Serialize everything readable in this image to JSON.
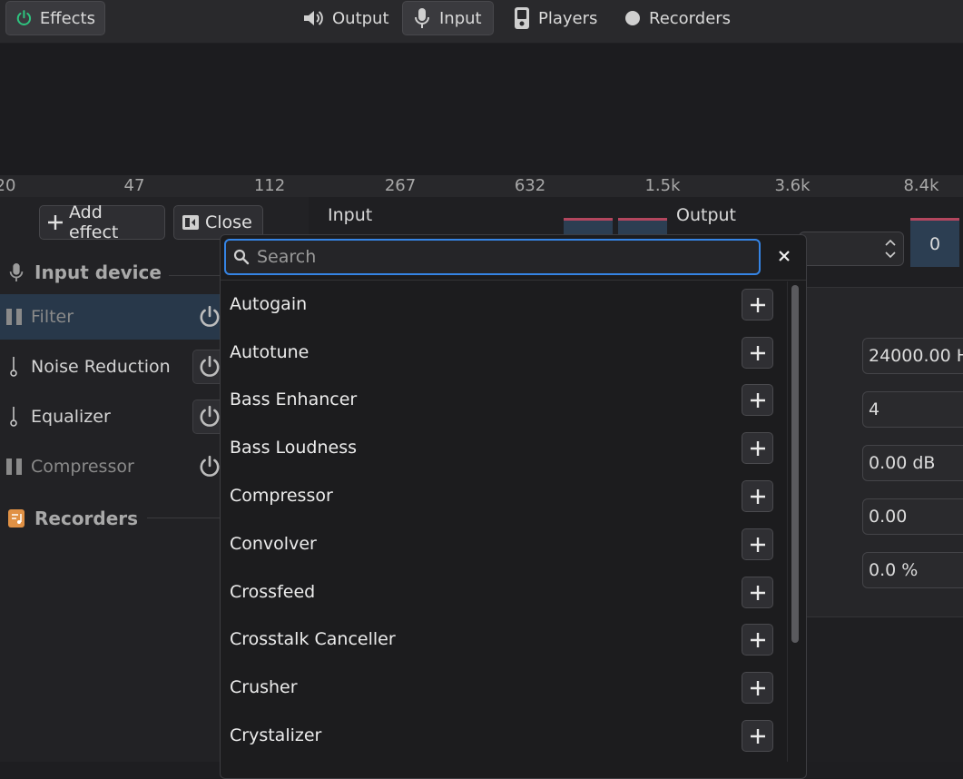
{
  "header": {
    "effects_label": "Effects",
    "tabs": [
      {
        "label": "Output",
        "icon": "speaker-icon"
      },
      {
        "label": "Input",
        "icon": "microphone-icon"
      },
      {
        "label": "Players",
        "icon": "player-device-icon"
      },
      {
        "label": "Recorders",
        "icon": "record-dot-icon"
      }
    ]
  },
  "frequency_axis": [
    "20",
    "47",
    "112",
    "267",
    "632",
    "1.5k",
    "3.6k",
    "8.4k"
  ],
  "toolbar": {
    "add_effect_label": "Add effect",
    "close_label": "Close"
  },
  "sidebar": {
    "input_device_label": "Input device",
    "items": [
      {
        "label": "Filter",
        "state": "paused"
      },
      {
        "label": "Noise Reduction",
        "state": "active"
      },
      {
        "label": "Equalizer",
        "state": "active"
      },
      {
        "label": "Compressor",
        "state": "paused"
      }
    ],
    "recorders_label": "Recorders"
  },
  "levels": {
    "input_label": "Input",
    "output_label": "Output",
    "output_value": "0"
  },
  "properties": {
    "values": [
      "24000.00 H",
      "4",
      "0.00 dB",
      "0.00",
      "0.0 %"
    ]
  },
  "popover": {
    "search_placeholder": "Search",
    "effects": [
      "Autogain",
      "Autotune",
      "Bass Enhancer",
      "Bass Loudness",
      "Compressor",
      "Convolver",
      "Crossfeed",
      "Crosstalk Canceller",
      "Crusher",
      "Crystalizer"
    ]
  },
  "colors": {
    "accent": "#3584e4",
    "power_green": "#2ec27e",
    "recorder_orange": "#e09145",
    "meter_red": "#b3465e",
    "selected_row": "#28384a"
  }
}
